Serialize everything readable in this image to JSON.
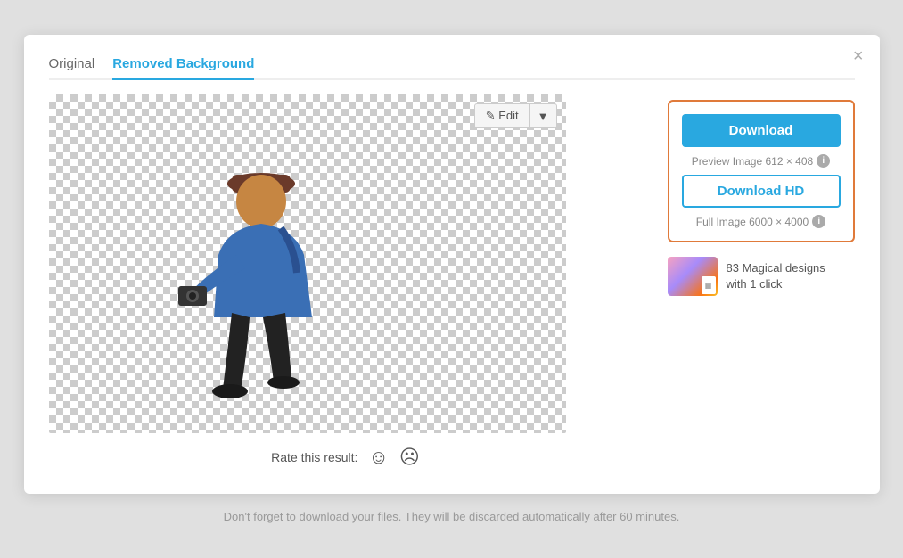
{
  "tabs": {
    "original_label": "Original",
    "removed_bg_label": "Removed Background",
    "active_tab": "removed_bg"
  },
  "close_button": "×",
  "edit_button": {
    "label": "✎ Edit",
    "dropdown_icon": "▼"
  },
  "download": {
    "button_label": "Download",
    "preview_info": "Preview Image 612 × 408",
    "hd_button_label": "Download HD",
    "full_info": "Full Image 6000 × 4000"
  },
  "promo": {
    "text_line1": "83 Magical designs",
    "text_line2": "with 1 click"
  },
  "rating": {
    "label": "Rate this result:"
  },
  "footer": {
    "text": "Don't forget to download your files. They will be discarded automatically after 60 minutes."
  }
}
